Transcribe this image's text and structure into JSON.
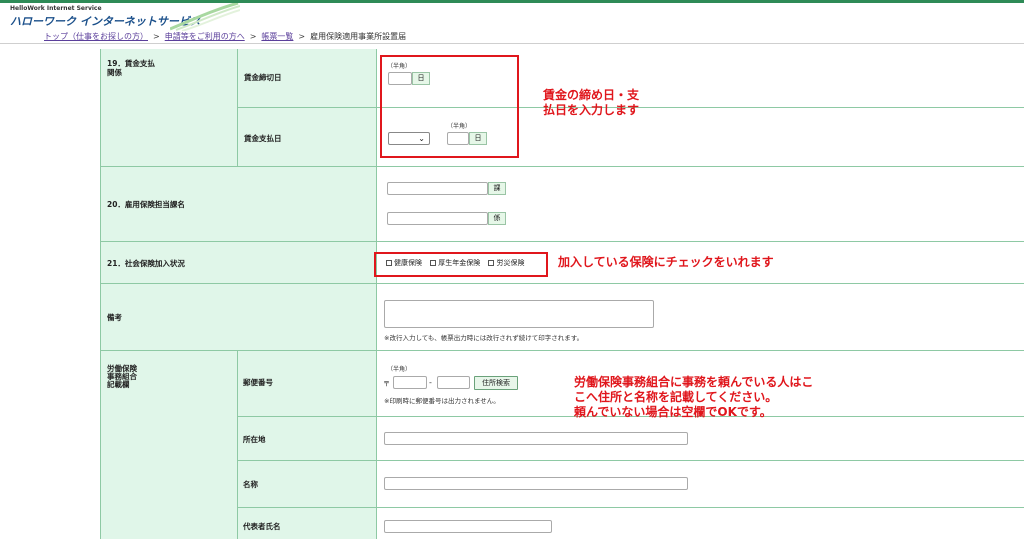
{
  "header": {
    "logo_sub": "HelloWork Internet Service",
    "logo_main": "ハローワーク インターネットサービス"
  },
  "breadcrumb": {
    "items": [
      "トップ（仕事をお探しの方）",
      "申請等をご利用の方へ",
      "帳票一覧"
    ],
    "current": "雇用保険適用事業所設置届",
    "separator": ">"
  },
  "form": {
    "row19": {
      "heading_line1": "19．賃金支払",
      "heading_line2": "関係",
      "closing_label": "賃金締切日",
      "closing_halfwidth": "（半角）",
      "closing_unit": "日",
      "payday_label": "賃金支払日",
      "payday_halfwidth": "（半角）",
      "payday_unit": "日"
    },
    "row20": {
      "heading": "20．雇用保険担当課名",
      "unit1": "課",
      "unit2": "係"
    },
    "row21": {
      "heading": "21．社会保険加入状況",
      "options": [
        "健康保険",
        "厚生年金保険",
        "労災保険"
      ]
    },
    "remarks": {
      "heading": "備考",
      "note": "※改行入力しても、帳票出力時には改行されず続けて印字されます。"
    },
    "labor": {
      "heading_line1": "労働保険",
      "heading_line2": "事務組合",
      "heading_line3": "記載欄",
      "postal_label": "郵便番号",
      "postal_halfwidth": "（半角）",
      "postal_mark": "〒",
      "postal_dash": "-",
      "address_search_button": "住所検索",
      "postal_note": "※印刷時に郵便番号は出力されません。",
      "address_label": "所在地",
      "name_label": "名称",
      "rep_label": "代表者氏名"
    }
  },
  "annotations": {
    "wage_note_line1": "賃金の締め日・支",
    "wage_note_line2": "払日を入力します",
    "insurance_note": "加入している保険にチェックをいれます",
    "labor_note_line1": "労働保険事務組合に事務を頼んでいる人はこ",
    "labor_note_line2": "こへ住所と名称を記載してください。",
    "labor_note_line3": "頼んでいない場合は空欄でOKです。"
  },
  "colors": {
    "accent_green": "#2e8b57",
    "label_bg": "#e0f6e9",
    "annotation_red": "#e0161c",
    "link_purple": "#5b3f9b"
  }
}
